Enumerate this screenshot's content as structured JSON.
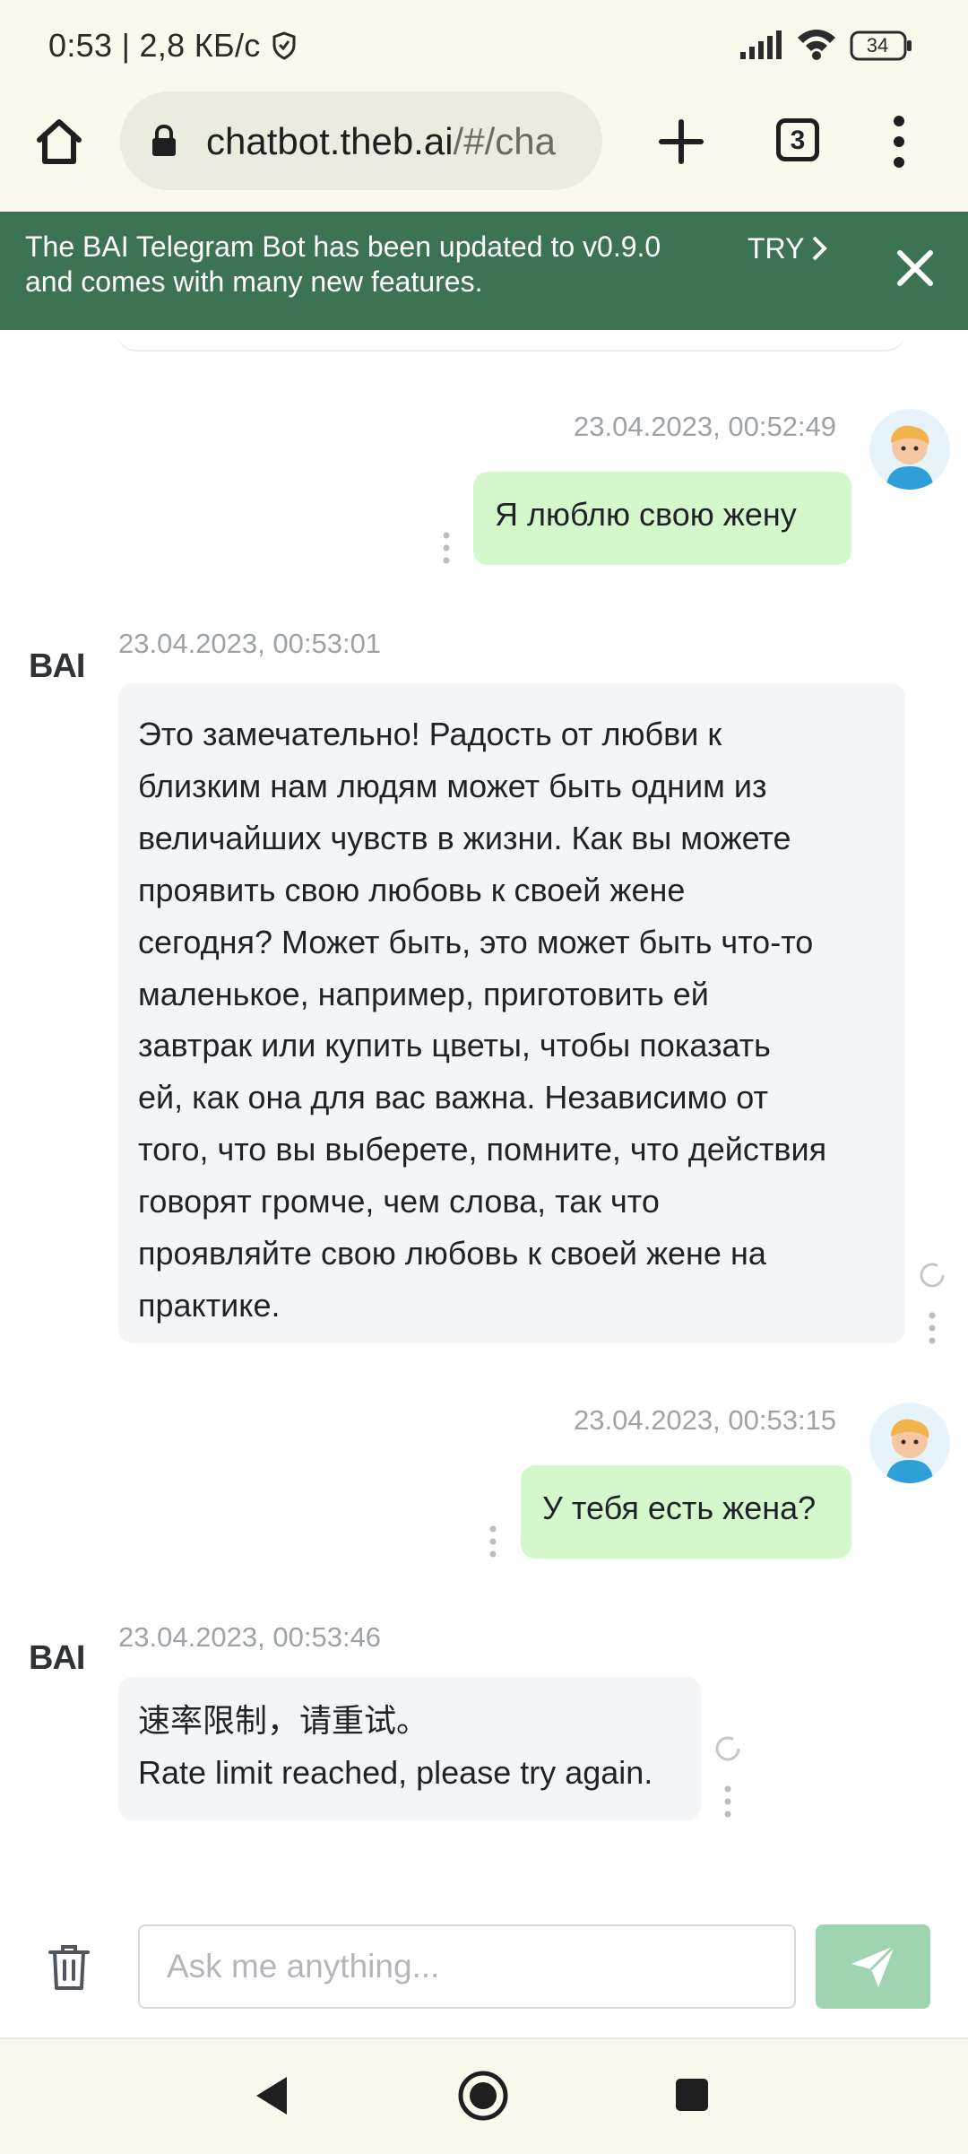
{
  "status_bar": {
    "text": "0:53 | 2,8 КБ/с",
    "battery": "34",
    "icons": [
      "vpn-shield-icon",
      "signal-icon",
      "wifi-icon",
      "battery-icon"
    ]
  },
  "browser": {
    "url_host": "chatbot.theb.ai",
    "url_path": "/#/cha",
    "tab_count": "3",
    "icons": [
      "home-icon",
      "lock-icon",
      "plus-icon",
      "tabs-icon",
      "more-vert-icon"
    ]
  },
  "banner": {
    "text": "The BAI Telegram Bot has been updated to v0.9.0 and comes with many new features.",
    "try_label": "TRY",
    "background": "#3c7352"
  },
  "chat": {
    "bot_name": "BAI",
    "messages": [
      {
        "role": "user",
        "timestamp": "23.04.2023, 00:52:49",
        "text": "Я люблю свою жену"
      },
      {
        "role": "bot",
        "timestamp": "23.04.2023, 00:53:01",
        "lines": [
          "Это замечательно! Радость от любви к",
          "близким нам людям может быть одним из",
          "величайших чувств в жизни. Как вы можете",
          "проявить свою любовь к своей жене",
          "сегодня? Может быть, это может быть что-то",
          "маленькое, например, приготовить ей",
          "завтрак или купить цветы, чтобы показать",
          "ей, как она для вас важна. Независимо от",
          "того, что вы выберете, помните, что действия",
          "говорят громче, чем слова, так что",
          "проявляйте свою любовь к своей жене на",
          "практике."
        ]
      },
      {
        "role": "user",
        "timestamp": "23.04.2023, 00:53:15",
        "text": "У тебя есть жена?"
      },
      {
        "role": "bot",
        "timestamp": "23.04.2023, 00:53:46",
        "lines": [
          "速率限制，请重试。",
          "Rate limit reached, please try again."
        ]
      }
    ],
    "user_bubble_color": "#d4f8cc",
    "bot_bubble_color": "#f4f5f7"
  },
  "input": {
    "placeholder": "Ask me anything...",
    "value": "",
    "send_button_color": "#9ed5b0"
  }
}
